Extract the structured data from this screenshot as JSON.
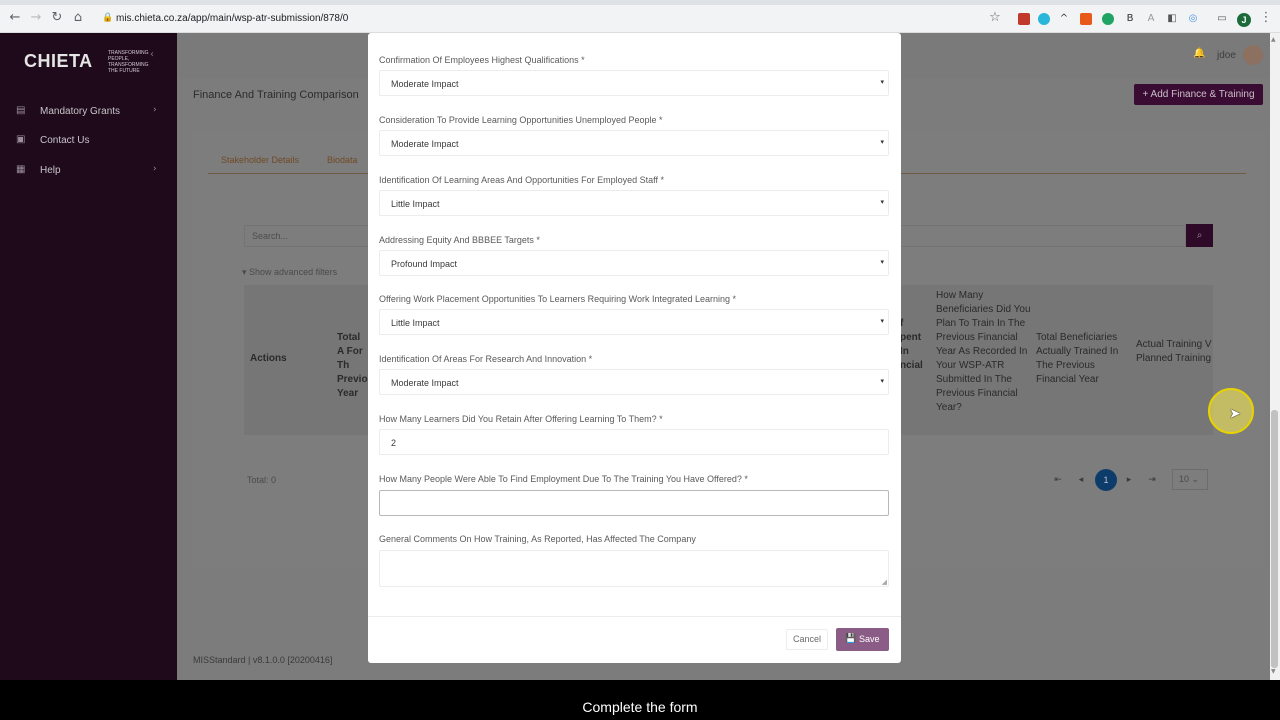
{
  "browser": {
    "url": "mis.chieta.co.za/app/main/wsp-atr-submission/878/0",
    "profile_initial": "J"
  },
  "sidebar": {
    "logo_text": "CHIETA",
    "logo_tagline": "TRANSFORMING PEOPLE, TRANSFORMING THE FUTURE",
    "items": [
      {
        "label": "Mandatory Grants",
        "icon": "grid-icon"
      },
      {
        "label": "Contact Us",
        "icon": "contact-icon"
      },
      {
        "label": "Help",
        "icon": "help-icon"
      }
    ]
  },
  "header": {
    "user_name": "jdoe"
  },
  "page": {
    "title": "Finance And Training Comparison",
    "add_button": "+ Add Finance & Training",
    "tabs": [
      "Stakeholder Details",
      "Biodata"
    ],
    "search_placeholder": "Search...",
    "advanced_filters": "Show advanced filters",
    "table_headers": {
      "actions": "Actions",
      "col1": "Total A For Th Previo Year",
      "col_partial": "f pent In ncial",
      "col_planned": "How Many Beneficiaries Did You Plan To Train In The Previous Financial Year As Recorded In Your WSP-ATR Submitted In The Previous Financial Year?",
      "col_actual": "Total Beneficiaries Actually Trained In The Previous Financial Year",
      "col_ratio": "Actual Training V Planned Training"
    },
    "total": "Total: 0",
    "page_current": "1",
    "page_size": "10",
    "footer": "MISStandard | v8.1.0.0 [20200416]"
  },
  "modal": {
    "fields": [
      {
        "label": "Confirmation Of Employees Highest Qualifications *",
        "value": "Moderate Impact",
        "type": "select"
      },
      {
        "label": "Consideration To Provide Learning Opportunities Unemployed People *",
        "value": "Moderate Impact",
        "type": "select"
      },
      {
        "label": "Identification Of Learning Areas And Opportunities For Employed Staff *",
        "value": "Little Impact",
        "type": "select"
      },
      {
        "label": "Addressing Equity And BBBEE Targets *",
        "value": "Profound Impact",
        "type": "select"
      },
      {
        "label": "Offering Work Placement Opportunities To Learners Requiring Work Integrated Learning *",
        "value": "Little Impact",
        "type": "select"
      },
      {
        "label": "Identification Of Areas For Research And Innovation *",
        "value": "Moderate Impact",
        "type": "select"
      },
      {
        "label": "How Many Learners Did You Retain After Offering Learning To Them? *",
        "value": "2",
        "type": "input"
      },
      {
        "label": "How Many People Were Able To Find Employment Due To The Training You Have Offered? *",
        "value": "",
        "type": "input"
      },
      {
        "label": "General Comments On How Training, As Reported, Has Affected The Company",
        "value": "",
        "type": "textarea"
      }
    ],
    "cancel": "Cancel",
    "save": "Save"
  },
  "caption": "Complete the form",
  "colors": {
    "sidebar_bg": "#1f0a1c",
    "accent": "#3a0b33",
    "save_button": "#8b5c86",
    "page_active": "#0d3c6b"
  }
}
